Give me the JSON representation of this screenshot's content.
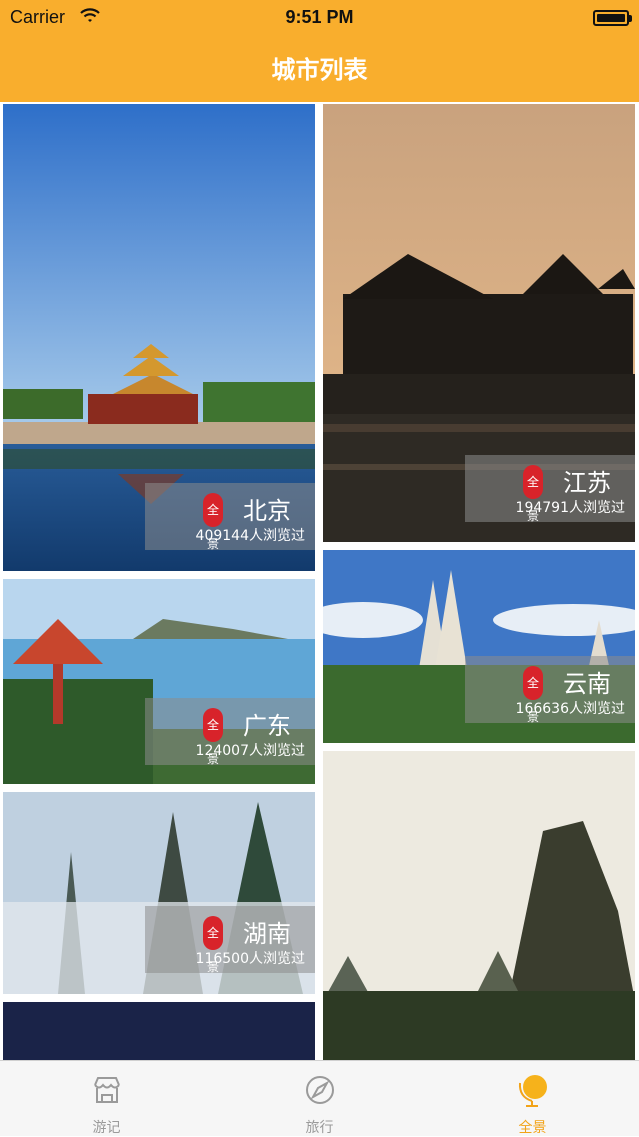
{
  "status_bar": {
    "carrier": "Carrier",
    "time": "9:51 PM"
  },
  "header": {
    "title": "城市列表"
  },
  "cities": [
    {
      "name": "北京",
      "views": "409144人浏览过",
      "badge": "全景"
    },
    {
      "name": "江苏",
      "views": "194791人浏览过",
      "badge": "全景"
    },
    {
      "name": "广东",
      "views": "124007人浏览过",
      "badge": "全景"
    },
    {
      "name": "云南",
      "views": "166636人浏览过",
      "badge": "全景"
    },
    {
      "name": "湖南",
      "views": "116500人浏览过",
      "badge": "全景"
    }
  ],
  "tabs": [
    {
      "label": "游记",
      "icon": "shop-icon"
    },
    {
      "label": "旅行",
      "icon": "compass-icon"
    },
    {
      "label": "全景",
      "icon": "globe-icon"
    }
  ],
  "colors": {
    "header_bg": "#F9AE2D",
    "accent": "#F2A318",
    "tab_inactive": "#9A9A9A"
  }
}
